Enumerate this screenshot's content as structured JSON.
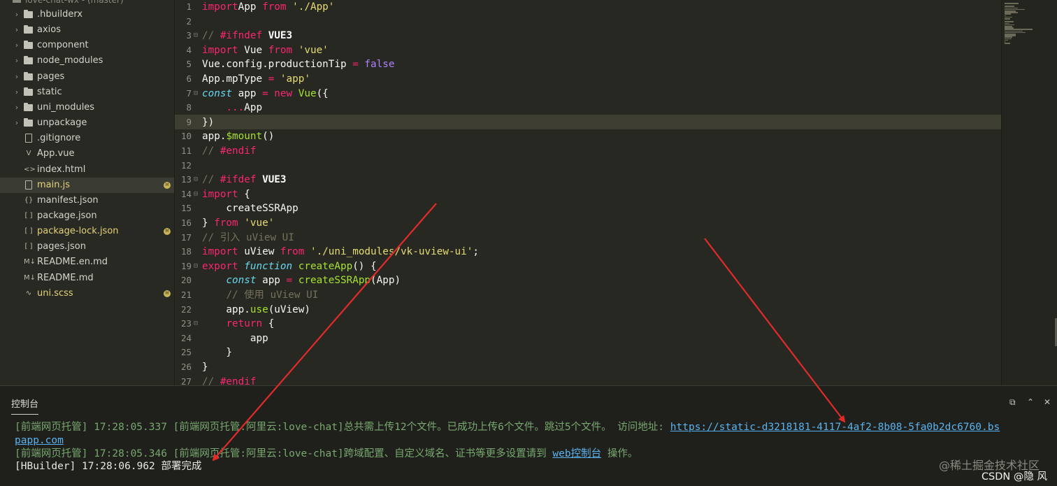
{
  "sidebar": {
    "project_title": "love-chat-wx - (master)",
    "items": [
      {
        "label": ".hbuilderx",
        "type": "folder",
        "badge": ""
      },
      {
        "label": "axios",
        "type": "folder",
        "badge": ""
      },
      {
        "label": "component",
        "type": "folder",
        "badge": ""
      },
      {
        "label": "node_modules",
        "type": "folder",
        "badge": ""
      },
      {
        "label": "pages",
        "type": "folder",
        "badge": ""
      },
      {
        "label": "static",
        "type": "folder",
        "badge": ""
      },
      {
        "label": "uni_modules",
        "type": "folder",
        "badge": ""
      },
      {
        "label": "unpackage",
        "type": "folder",
        "badge": ""
      },
      {
        "label": ".gitignore",
        "type": "file",
        "badge": ""
      },
      {
        "label": "App.vue",
        "type": "vue",
        "badge": ""
      },
      {
        "label": "index.html",
        "type": "html",
        "badge": ""
      },
      {
        "label": "main.js",
        "type": "js",
        "badge": "M",
        "selected": true
      },
      {
        "label": "manifest.json",
        "type": "manifest",
        "badge": ""
      },
      {
        "label": "package.json",
        "type": "json",
        "badge": ""
      },
      {
        "label": "package-lock.json",
        "type": "json",
        "badge": "M"
      },
      {
        "label": "pages.json",
        "type": "json",
        "badge": ""
      },
      {
        "label": "README.en.md",
        "type": "md",
        "badge": ""
      },
      {
        "label": "README.md",
        "type": "md",
        "badge": ""
      },
      {
        "label": "uni.scss",
        "type": "scss",
        "badge": "M"
      }
    ]
  },
  "editor": {
    "current_line": 9,
    "lines": [
      {
        "n": "1",
        "fold": "",
        "tokens": [
          [
            "kw",
            "import"
          ],
          [
            "",
            "App "
          ],
          [
            "kw",
            "from"
          ],
          [
            "",
            ""
          ],
          [
            "str",
            " './App'"
          ]
        ]
      },
      {
        "n": "2",
        "fold": "",
        "tokens": []
      },
      {
        "n": "3",
        "fold": "⊟",
        "tokens": [
          [
            "com",
            "// "
          ],
          [
            "kw",
            "#ifndef"
          ],
          [
            "white-b",
            " VUE3"
          ]
        ]
      },
      {
        "n": "4",
        "fold": "",
        "tokens": [
          [
            "kw",
            "import"
          ],
          [
            "",
            " Vue "
          ],
          [
            "kw",
            "from"
          ],
          [
            "str",
            " 'vue'"
          ]
        ]
      },
      {
        "n": "5",
        "fold": "",
        "tokens": [
          [
            "",
            "Vue.config.productionTip "
          ],
          [
            "op",
            "="
          ],
          [
            "bool",
            " false"
          ]
        ]
      },
      {
        "n": "6",
        "fold": "",
        "tokens": [
          [
            "",
            "App.mpType "
          ],
          [
            "op",
            "="
          ],
          [
            "str",
            " 'app'"
          ]
        ]
      },
      {
        "n": "7",
        "fold": "⊟",
        "tokens": [
          [
            "ital",
            "const"
          ],
          [
            "",
            " app "
          ],
          [
            "op",
            "="
          ],
          [
            "kw",
            " new"
          ],
          [
            "cls",
            " Vue"
          ],
          [
            "",
            "({"
          ]
        ]
      },
      {
        "n": "8",
        "fold": "",
        "tokens": [
          [
            "",
            "    "
          ],
          [
            "op",
            "..."
          ],
          [
            "",
            "App"
          ]
        ]
      },
      {
        "n": "9",
        "fold": "",
        "tokens": [
          [
            "",
            "})"
          ]
        ]
      },
      {
        "n": "10",
        "fold": "",
        "tokens": [
          [
            "",
            "app."
          ],
          [
            "fn",
            "$mount"
          ],
          [
            "",
            "()"
          ]
        ]
      },
      {
        "n": "11",
        "fold": "",
        "tokens": [
          [
            "com",
            "// "
          ],
          [
            "kw",
            "#endif"
          ]
        ]
      },
      {
        "n": "12",
        "fold": "",
        "tokens": []
      },
      {
        "n": "13",
        "fold": "⊟",
        "tokens": [
          [
            "com",
            "// "
          ],
          [
            "kw",
            "#ifdef"
          ],
          [
            "white-b",
            " VUE3"
          ]
        ]
      },
      {
        "n": "14",
        "fold": "⊟",
        "tokens": [
          [
            "kw",
            "import"
          ],
          [
            "",
            " {"
          ]
        ]
      },
      {
        "n": "15",
        "fold": "",
        "tokens": [
          [
            "",
            "    createSSRApp"
          ]
        ]
      },
      {
        "n": "16",
        "fold": "",
        "tokens": [
          [
            "",
            "} "
          ],
          [
            "kw",
            "from"
          ],
          [
            "str",
            " 'vue'"
          ]
        ]
      },
      {
        "n": "17",
        "fold": "",
        "tokens": [
          [
            "com",
            "// 引入 uView UI"
          ]
        ]
      },
      {
        "n": "18",
        "fold": "",
        "tokens": [
          [
            "kw",
            "import"
          ],
          [
            "",
            " uView "
          ],
          [
            "kw",
            "from"
          ],
          [
            "str",
            " './uni_modules/vk-uview-ui'"
          ],
          [
            "",
            ";"
          ]
        ]
      },
      {
        "n": "19",
        "fold": "⊟",
        "tokens": [
          [
            "kw",
            "export"
          ],
          [
            "ital",
            " function"
          ],
          [
            "fn",
            " createApp"
          ],
          [
            "",
            "() {"
          ]
        ]
      },
      {
        "n": "20",
        "fold": "",
        "tokens": [
          [
            "",
            "    "
          ],
          [
            "ital",
            "const"
          ],
          [
            "",
            " app "
          ],
          [
            "op",
            "="
          ],
          [
            "fn",
            " createSSRApp"
          ],
          [
            "",
            "(App)"
          ]
        ]
      },
      {
        "n": "21",
        "fold": "",
        "tokens": [
          [
            "",
            "    "
          ],
          [
            "com",
            "// 使用 uView UI"
          ]
        ]
      },
      {
        "n": "22",
        "fold": "",
        "tokens": [
          [
            "",
            "    app."
          ],
          [
            "fn",
            "use"
          ],
          [
            "",
            "(uView)"
          ]
        ]
      },
      {
        "n": "23",
        "fold": "⊟",
        "tokens": [
          [
            "",
            "    "
          ],
          [
            "kw",
            "return"
          ],
          [
            "",
            " {"
          ]
        ]
      },
      {
        "n": "24",
        "fold": "",
        "tokens": [
          [
            "",
            "        app"
          ]
        ]
      },
      {
        "n": "25",
        "fold": "",
        "tokens": [
          [
            "",
            "    }"
          ]
        ]
      },
      {
        "n": "26",
        "fold": "",
        "tokens": [
          [
            "",
            "}"
          ]
        ]
      },
      {
        "n": "27",
        "fold": "",
        "tokens": [
          [
            "com",
            "// "
          ],
          [
            "kw",
            "#endif"
          ]
        ]
      }
    ]
  },
  "console": {
    "tab_label": "控制台",
    "lines": [
      {
        "parts": [
          [
            "",
            "[前端网页托管] 17:28:05.337 [前端网页托管:阿里云:love-chat]总共需上传12个文件。已成功上传6个文件。跳过5个文件。   访问地址: "
          ],
          [
            "link",
            "https://static-d3218181-4117-4af2-8b08-5fa0b2dc6760.bs"
          ]
        ]
      },
      {
        "parts": [
          [
            "link",
            "papp.com"
          ]
        ]
      },
      {
        "parts": [
          [
            "",
            "[前端网页托管] 17:28:05.346 [前端网页托管:阿里云:love-chat]跨域配置、自定义域名、证书等更多设置请到 "
          ],
          [
            "link",
            "web控制台"
          ],
          [
            "",
            " 操作。"
          ]
        ]
      },
      {
        "parts": [
          [
            "white",
            "[HBuilder] 17:28:06.962 部署完成"
          ]
        ]
      }
    ],
    "watermark": "@稀土掘金技术社区",
    "csdn": "CSDN @隐 风"
  }
}
